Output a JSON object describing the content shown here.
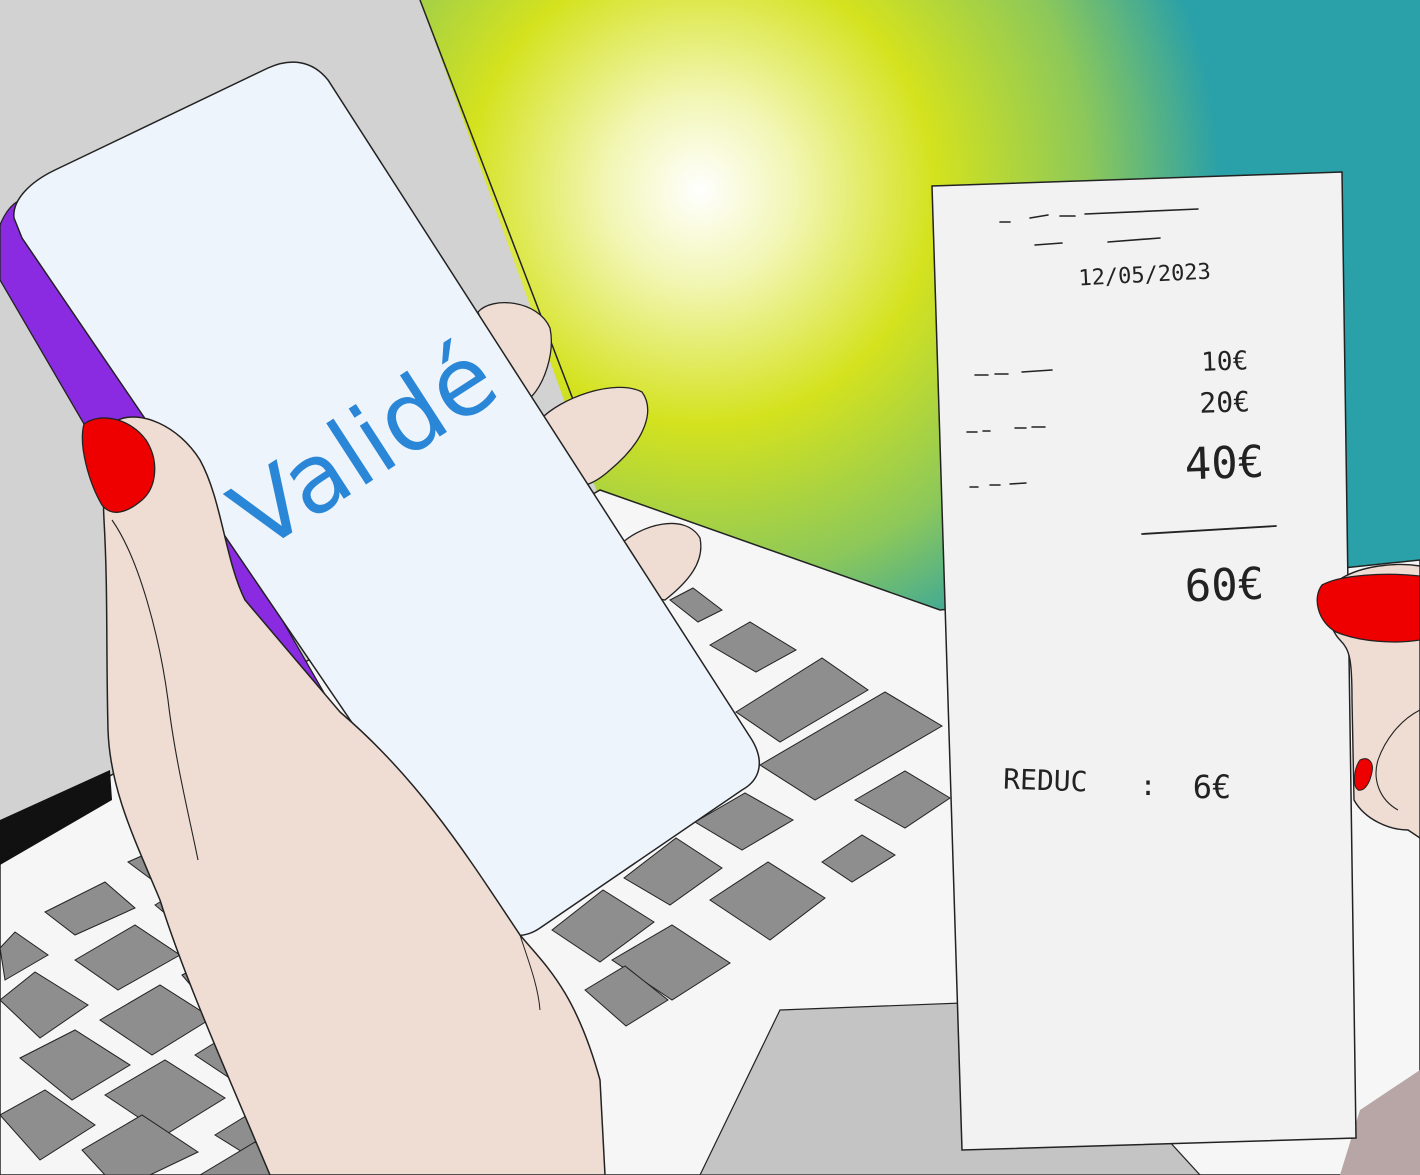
{
  "phone": {
    "screen_text": "Validé",
    "screen_text_color": "#2a86d6",
    "screen_color": "#eef4fc",
    "case_color": "#8a2be2"
  },
  "receipt": {
    "date": "12/05/2023",
    "line_items": [
      {
        "amount": "10€"
      },
      {
        "amount": "20€"
      },
      {
        "amount": "40€"
      }
    ],
    "total": "60€",
    "discount_label": "REDUC",
    "discount_separator": ":",
    "discount_value": "6€"
  },
  "colors": {
    "background_gray": "#d2d2d2",
    "background_yellow": "#d4e21e",
    "background_teal": "#2aa0a8",
    "skin": "#efdcd3",
    "nail_polish": "#ee0000",
    "laptop_body": "#f6f6f6",
    "keycap": "#8e8e8e",
    "paper": "#f2f2f2"
  }
}
